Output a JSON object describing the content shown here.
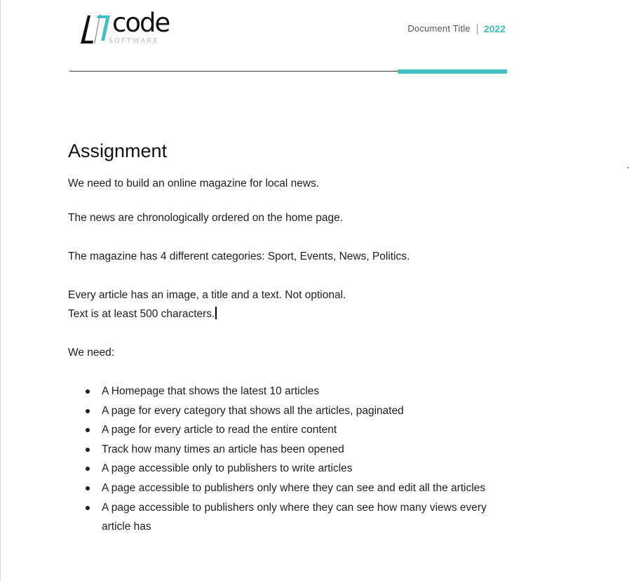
{
  "header": {
    "logo_word": "code",
    "logo_sub": "SOFTWARE",
    "document_title": "Document Title",
    "year": "2022"
  },
  "colors": {
    "accent": "#44bfc4",
    "text": "#202020"
  },
  "body": {
    "heading": "Assignment",
    "paragraphs": [
      "We need to build an online magazine for local news.",
      "The news are chronologically ordered on the home page.",
      "The magazine has 4 different categories: Sport, Events, News, Politics.",
      "Every article has an image, a title and a text. Not optional.",
      "Text is at least 500 characters.",
      "We need:"
    ],
    "bullets": [
      "A Homepage that shows the latest 10 articles",
      "A page for every category that shows all the articles, paginated",
      "A page for every article to read the entire content",
      "Track how many times an article has been opened",
      "A page accessible only to publishers to write articles",
      "A page accessible to publishers only where they can see and edit all the articles",
      "A page accessible to publishers only where they can see how many views every article has"
    ]
  }
}
